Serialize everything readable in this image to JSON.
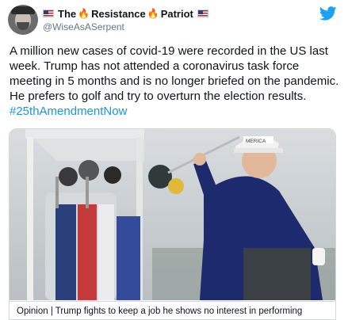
{
  "author": {
    "display_name_part1": "The",
    "display_name_part2": "Resistance",
    "display_name_part3": "Patriot",
    "handle": "@WiseAsASerpent",
    "flag_icon": "us-flag-icon",
    "fire_icon": "fire-icon"
  },
  "tweet": {
    "text": "A million new cases of covid-19 were recorded in the US last week. Trump has not attended a coronavirus task force meeting in 5 months and is no longer briefed on the pandemic. He prefers to golf and try to overturn the election results. ",
    "hashtag": "#25thAmendmentNow"
  },
  "card": {
    "caption": "Opinion | Trump fights to keep a job he shows no interest in performing",
    "hat_text": "MERICA"
  },
  "colors": {
    "link": "#1b95e0",
    "twitter_blue": "#1da1f2"
  }
}
